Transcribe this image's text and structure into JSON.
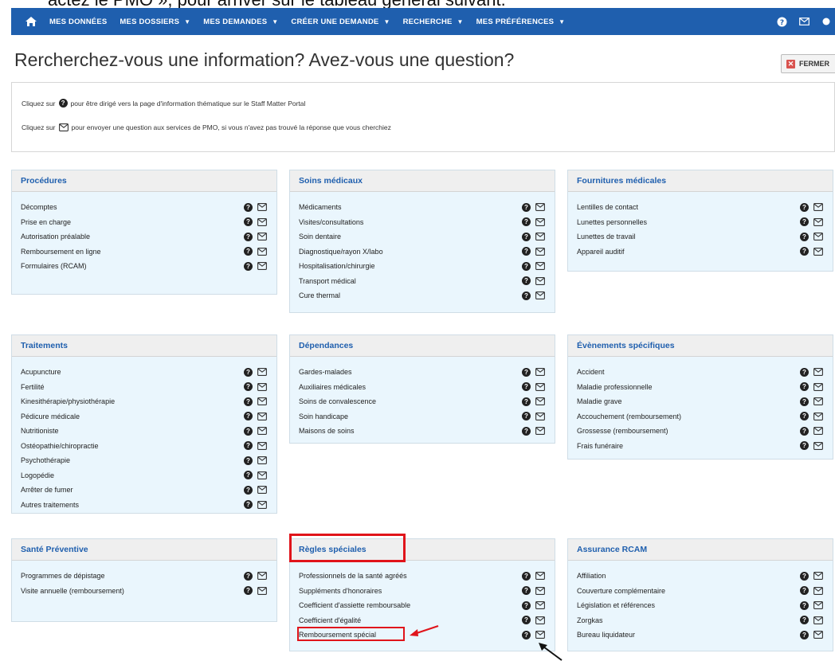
{
  "caption": "actez le PMO », pour arriver sur le tableau général suivant.",
  "navbar": {
    "items": [
      {
        "label": "MES DONNÉES",
        "caret": false
      },
      {
        "label": "MES DOSSIERS",
        "caret": true
      },
      {
        "label": "MES DEMANDES",
        "caret": true
      },
      {
        "label": "CRÉER UNE DEMANDE",
        "caret": true
      },
      {
        "label": "RECHERCHE",
        "caret": true
      },
      {
        "label": "MES PRÉFÉRENCES",
        "caret": true
      }
    ]
  },
  "page_title": "Rercherchez-vous une information? Avez-vous une question?",
  "close_label": "FERMER",
  "info": {
    "line1_pre": "Cliquez sur",
    "line1_post": "pour être dirigé vers la page d'information thématique sur le Staff Matter Portal",
    "line2_pre": "Cliquez sur",
    "line2_post": "pour envoyer une question aux services de PMO, si vous n'avez pas trouvé la réponse que vous cherchiez"
  },
  "icons": {
    "question": "question-circle-icon",
    "mail": "envelope-icon",
    "home": "home-icon"
  },
  "panels": [
    {
      "title": "Procédures",
      "items": [
        "Décomptes",
        "Prise en charge",
        "Autorisation préalable",
        "Remboursement en ligne",
        "Formulaires (RCAM)"
      ]
    },
    {
      "title": "Soins médicaux",
      "items": [
        "Médicaments",
        "Visites/consultations",
        "Soin dentaire",
        "Diagnostique/rayon X/labo",
        "Hospitalisation/chirurgie",
        "Transport médical",
        "Cure thermal"
      ]
    },
    {
      "title": "Fournitures médicales",
      "items": [
        "Lentilles de contact",
        "Lunettes personnelles",
        "Lunettes de travail",
        "Appareil auditif"
      ]
    },
    {
      "title": "Traitements",
      "items": [
        "Acupuncture",
        "Fertilité",
        "Kinesithérapie/physiothérapie",
        "Pédicure médicale",
        "Nutritioniste",
        "Ostéopathie/chiropractie",
        "Psychothérapie",
        "Logopédie",
        "Arrêter de fumer",
        "Autres traitements"
      ]
    },
    {
      "title": "Dépendances",
      "items": [
        "Gardes-malades",
        "Auxiliaires médicales",
        "Soins de convalescence",
        "Soin handicape",
        "Maisons de soins"
      ]
    },
    {
      "title": "Évènements spécifiques",
      "items": [
        "Accident",
        "Maladie professionnelle",
        "Maladie grave",
        "Accouchement (remboursement)",
        "Grossesse (remboursement)",
        "Frais funéraire"
      ]
    },
    {
      "title": "Santé Préventive",
      "items": [
        "Programmes de dépistage",
        "Visite annuelle (remboursement)"
      ]
    },
    {
      "title": "Règles spéciales",
      "items": [
        "Professionnels de la santé agréés",
        "Suppléments d'honoraires",
        "Coefficient d'assiette remboursable",
        "Coefficient d'égalité",
        "Remboursement spécial"
      ]
    },
    {
      "title": "Assurance RCAM",
      "items": [
        "Affiliation",
        "Couverture complémentaire",
        "Législation et références",
        "Zorgkas",
        "Bureau liquidateur"
      ]
    }
  ],
  "colors": {
    "nav": "#1f5fae",
    "panel_bg": "#eaf6fd",
    "title": "#1f5fae",
    "highlight": "#e0141b"
  }
}
